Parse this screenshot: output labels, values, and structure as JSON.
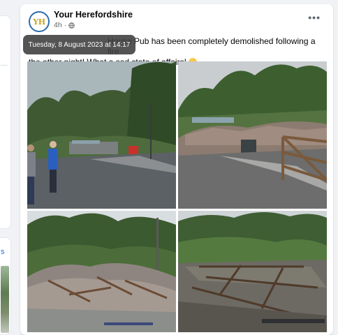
{
  "post": {
    "page_name": "Your Herefordshire",
    "time_ago": "4h",
    "separator": "·",
    "avatar_initials": "YH",
    "tooltip_time": "Tuesday, 8 August 2023 at 14:17",
    "text_line1": "House Pub has been completely demolished following a fire",
    "text_line2": "the other night! What a sad state of affairs!",
    "more_label": "•••",
    "photos": [
      {
        "name": "photo-street-view"
      },
      {
        "name": "photo-rubble-gate"
      },
      {
        "name": "photo-debris-pile"
      },
      {
        "name": "photo-burnt-timbers"
      }
    ]
  },
  "sidebar": {
    "see_more": "s"
  },
  "icons": [
    "globe-icon",
    "more-options-icon",
    "sad-emoji-icon"
  ]
}
